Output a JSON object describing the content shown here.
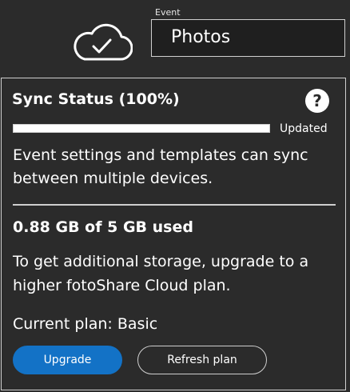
{
  "header": {
    "cloud_icon": "cloud-check-icon",
    "event_label": "Event",
    "event_value": "Photos"
  },
  "sync": {
    "title": "Sync Status (100%)",
    "progress": 1.0,
    "status": "Updated",
    "description": "Event settings and templates can sync between multiple devices.",
    "help_icon": "help-icon",
    "help_glyph": "?"
  },
  "storage": {
    "usage": "0.88 GB of 5 GB used",
    "description": "To get additional storage, upgrade to a higher fotoShare Cloud plan.",
    "current_plan": "Current plan: Basic"
  },
  "buttons": {
    "upgrade_label": "Upgrade",
    "refresh_label": "Refresh plan"
  },
  "colors": {
    "background": "#2b2b2b",
    "accent": "#1372c6",
    "border": "#cfcfcf",
    "text": "#ffffff"
  }
}
